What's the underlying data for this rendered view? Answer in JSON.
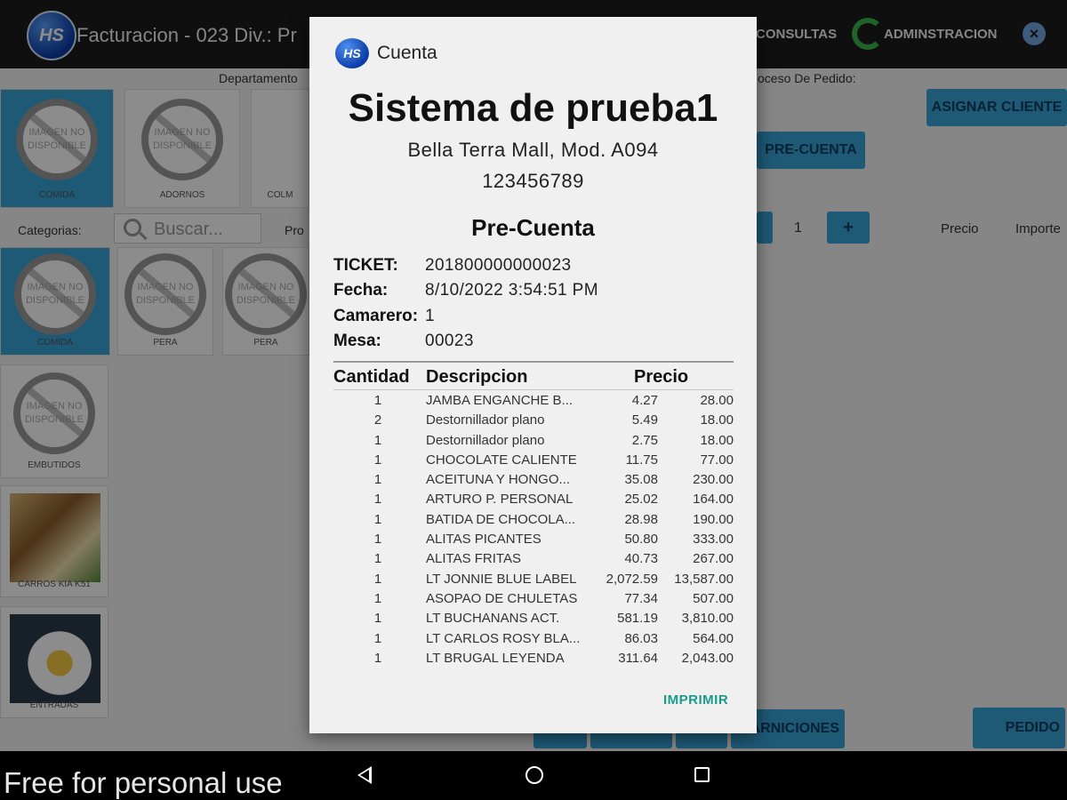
{
  "app": {
    "title": "Facturacion - 023 Div.: Pr",
    "logo_text": "HS",
    "nav_consultas": "CONSULTAS",
    "nav_admin": "ADMINSTRACION",
    "departamento_label": "Departamento",
    "proceso_label": "oceso De Pedido:",
    "categorias_label": "Categorias:",
    "search_placeholder": "Buscar...",
    "pro_label": "Pro",
    "asignar_cliente": "ASIGNAR CLIENTE",
    "pre_cuenta_btn": "PRE-CUENTA",
    "qty_value": "1",
    "plus": "+",
    "col_precio": "Precio",
    "col_importe": "Importe",
    "guarniciones_btn": "ARNICIONES",
    "pedido_btn": "PEDIDO",
    "no_image_text": "IMAGEN NO DISPONIBLE",
    "dept_tiles": [
      "COMIDA",
      "ADORNOS",
      "COLM"
    ],
    "cat_tiles": [
      "COMIDA",
      "PERA",
      "PERA"
    ],
    "side_tiles": [
      "EMBUTIDOS",
      "CARROS KIA K51",
      "ENTRADAS"
    ]
  },
  "dialog": {
    "logo_text": "HS",
    "title": "Cuenta",
    "business_name": "Sistema de prueba1",
    "address": "Bella Terra Mall, Mod. A094",
    "phone": "123456789",
    "doc_title": "Pre-Cuenta",
    "ticket_label": "TICKET:",
    "ticket_value": "201800000000023",
    "fecha_label": "Fecha:",
    "fecha_value": "8/10/2022 3:54:51 PM",
    "camarero_label": "Camarero:",
    "camarero_value": "1",
    "mesa_label": "Mesa:",
    "mesa_value": "00023",
    "col_cantidad": "Cantidad",
    "col_descripcion": "Descripcion",
    "col_precio": "Precio",
    "items": [
      {
        "qty": "1",
        "desc": "JAMBA ENGANCHE B...",
        "price": "4.27",
        "total": "28.00"
      },
      {
        "qty": "2",
        "desc": "Destornillador plano",
        "price": "5.49",
        "total": "18.00"
      },
      {
        "qty": "1",
        "desc": "Destornillador plano",
        "price": "2.75",
        "total": "18.00"
      },
      {
        "qty": "1",
        "desc": "CHOCOLATE CALIENTE",
        "price": "11.75",
        "total": "77.00"
      },
      {
        "qty": "1",
        "desc": "ACEITUNA Y HONGO...",
        "price": "35.08",
        "total": "230.00"
      },
      {
        "qty": "1",
        "desc": "ARTURO P. PERSONAL",
        "price": "25.02",
        "total": "164.00"
      },
      {
        "qty": "1",
        "desc": "BATIDA DE CHOCOLA...",
        "price": "28.98",
        "total": "190.00"
      },
      {
        "qty": "1",
        "desc": "ALITAS PICANTES",
        "price": "50.80",
        "total": "333.00"
      },
      {
        "qty": "1",
        "desc": "ALITAS FRITAS",
        "price": "40.73",
        "total": "267.00"
      },
      {
        "qty": "1",
        "desc": "LT JONNIE BLUE LABEL",
        "price": "2,072.59",
        "total": "13,587.00"
      },
      {
        "qty": "1",
        "desc": "ASOPAO DE CHULETAS",
        "price": "77.34",
        "total": "507.00"
      },
      {
        "qty": "1",
        "desc": "LT BUCHANANS ACT.",
        "price": "581.19",
        "total": "3,810.00"
      },
      {
        "qty": "1",
        "desc": "LT CARLOS ROSY BLA...",
        "price": "86.03",
        "total": "564.00"
      },
      {
        "qty": "1",
        "desc": "LT BRUGAL LEYENDA",
        "price": "311.64",
        "total": "2,043.00"
      }
    ],
    "print_button": "IMPRIMIR"
  },
  "watermark": "Free for personal use",
  "colors": {
    "accent_blue": "#37a3d8",
    "print_teal": "#1a9a8a",
    "topbar": "#1c1c1c"
  },
  "icons": [
    "hs-logo-icon",
    "admin-ring-icon",
    "close-icon",
    "search-icon",
    "nav-back-icon",
    "nav-home-icon",
    "nav-recent-icon"
  ]
}
